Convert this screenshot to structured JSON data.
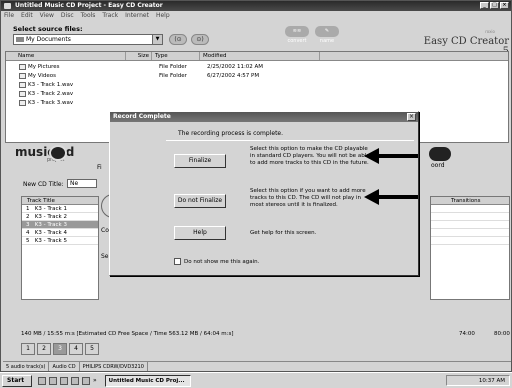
{
  "window": {
    "title": "Untitled Music CD Project - Easy CD Creator",
    "controls": [
      "_",
      "□",
      "×"
    ]
  },
  "menu": [
    "File",
    "Edit",
    "View",
    "Disc",
    "Tools",
    "Track",
    "Internet",
    "Help"
  ],
  "source": {
    "label": "Select source files:",
    "selected": "My Documents",
    "buttons": {
      "back": "(⊙",
      "fwd": "⊙)"
    }
  },
  "toolbar": {
    "convert": "convert",
    "name": "name"
  },
  "brand": {
    "name": "Easy CD Creator 5",
    "sub": "roxio"
  },
  "filelist": {
    "columns": [
      "Name",
      "Size",
      "Type",
      "Modified"
    ],
    "rows": [
      {
        "name": "My Pictures",
        "type": "File Folder",
        "modified": "2/25/2002 11:02 AM"
      },
      {
        "name": "My Videos",
        "type": "File Folder",
        "modified": "6/27/2002 4:57 PM"
      },
      {
        "name": "K3 - Track 1.wav",
        "type": "",
        "modified": ""
      },
      {
        "name": "K3 - Track 2.wav",
        "type": "",
        "modified": ""
      },
      {
        "name": "K3 - Track 3.wav",
        "type": "",
        "modified": ""
      }
    ]
  },
  "project": {
    "logo": "music cd",
    "sub": "project",
    "fi_label": "Fi",
    "title_label": "New CD Title:",
    "title_value": "Ne",
    "co_label": "Co",
    "se_label": "Sel",
    "record_label": "oord"
  },
  "tracks": {
    "header": "Track Title",
    "rows": [
      {
        "num": "1",
        "title": "K3 - Track 1"
      },
      {
        "num": "2",
        "title": "K3 - Track 2"
      },
      {
        "num": "3",
        "title": "K3 - Track 3"
      },
      {
        "num": "4",
        "title": "K3 - Track 4"
      },
      {
        "num": "5",
        "title": "K3 - Track 5"
      }
    ],
    "transitions_header": "Transitions"
  },
  "freespace": "140 MB / 15:55 m:s [Estimated CD Free Space / Time 563.12 MB / 64:04 m:s]",
  "markers": {
    "m1": "74:00",
    "m2": "80:00"
  },
  "pages": [
    "1",
    "2",
    "3",
    "4",
    "5"
  ],
  "status": [
    "5 audio track(s)",
    "Audio CD",
    "PHILIPS CDRW/DVD3210",
    ""
  ],
  "dialog": {
    "title": "Record Complete",
    "message": "The recording process is complete.",
    "finalize": "Finalize",
    "finalize_desc": "Select this option to make the CD playable in standard CD players. You will not be able to add more tracks to this CD in the future.",
    "not_finalize": "Do not Finalize",
    "not_finalize_desc": "Select this option if you want to add more tracks to this CD. The CD will not play in most stereos until it is finalized.",
    "help": "Help",
    "help_desc": "Get help for this screen.",
    "dont_show": "Do not show me this again."
  },
  "taskbar": {
    "start": "Start",
    "more": "»",
    "task": "Untitled Music CD Proj...",
    "clock": "10:37 AM"
  }
}
